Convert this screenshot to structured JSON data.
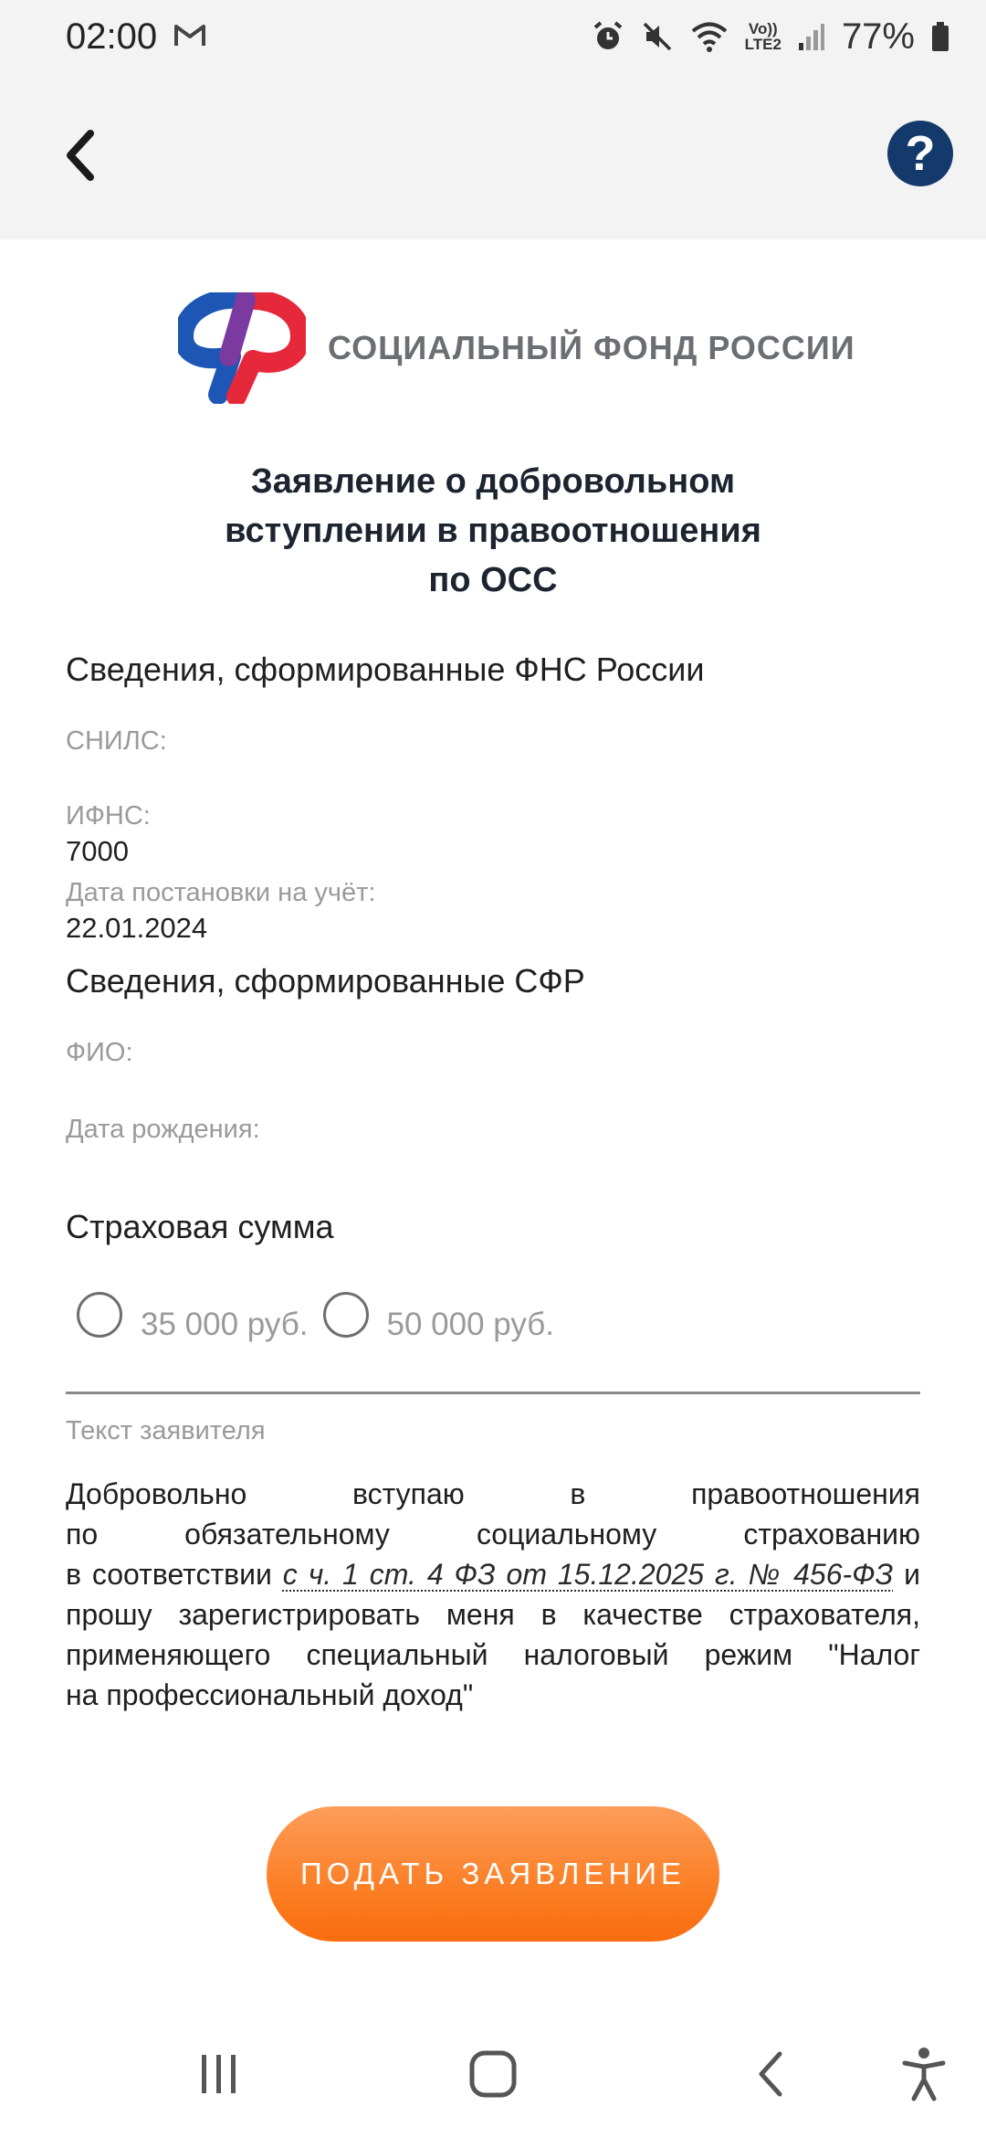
{
  "status_bar": {
    "time": "02:00",
    "lte_line1": "Vo))",
    "lte_line2": "LTE2",
    "battery": "77%"
  },
  "header": {
    "back_icon": "chevron-left-icon",
    "help_label": "?"
  },
  "logo": {
    "org_name": "СОЦИАЛЬНЫЙ ФОНД РОССИИ",
    "colors": {
      "blue": "#1e56b6",
      "red": "#e5283a"
    }
  },
  "title": {
    "line1": "Заявление о добровольном",
    "line2": "вступлении в правоотношения",
    "line3": "по ОСС"
  },
  "fns_section": {
    "heading": "Сведения, сформированные ФНС России",
    "snils_label": "СНИЛС:",
    "ifns_label": "ИФНС:",
    "ifns_value": "7000",
    "reg_date_label": "Дата постановки на учёт:",
    "reg_date_value": "22.01.2024"
  },
  "sfr_section": {
    "heading": "Сведения, сформированные СФР",
    "fio_label": "ФИО:",
    "birth_label": "Дата рождения:"
  },
  "insurance": {
    "heading": "Страховая сумма",
    "options": [
      {
        "label": "35 000 руб.",
        "selected": false
      },
      {
        "label": "50 000 руб.",
        "selected": false
      }
    ]
  },
  "applicant_text": {
    "label": "Текст заявителя",
    "line1": "Добровольно вступаю в правоотношения",
    "line2": "по обязательному социальному страхованию",
    "line3_pre": "в соответствии ",
    "line3_link": "с ч. 1 ст. 4 ФЗ от 15.12.2025 г. № 456-ФЗ",
    "line3_post": " и",
    "line4": "прошу зарегистрировать меня в качестве страхователя,",
    "line5": "применяющего специальный налоговый режим \"Налог",
    "line6": "на профессиональный доход\""
  },
  "submit": {
    "label": "ПОДАТЬ ЗАЯВЛЕНИЕ",
    "color": "#fb7a1d"
  },
  "navigation": {
    "recent_icon": "recent-apps-icon",
    "home_icon": "home-icon",
    "back_icon": "back-icon",
    "accessibility_icon": "accessibility-icon"
  }
}
